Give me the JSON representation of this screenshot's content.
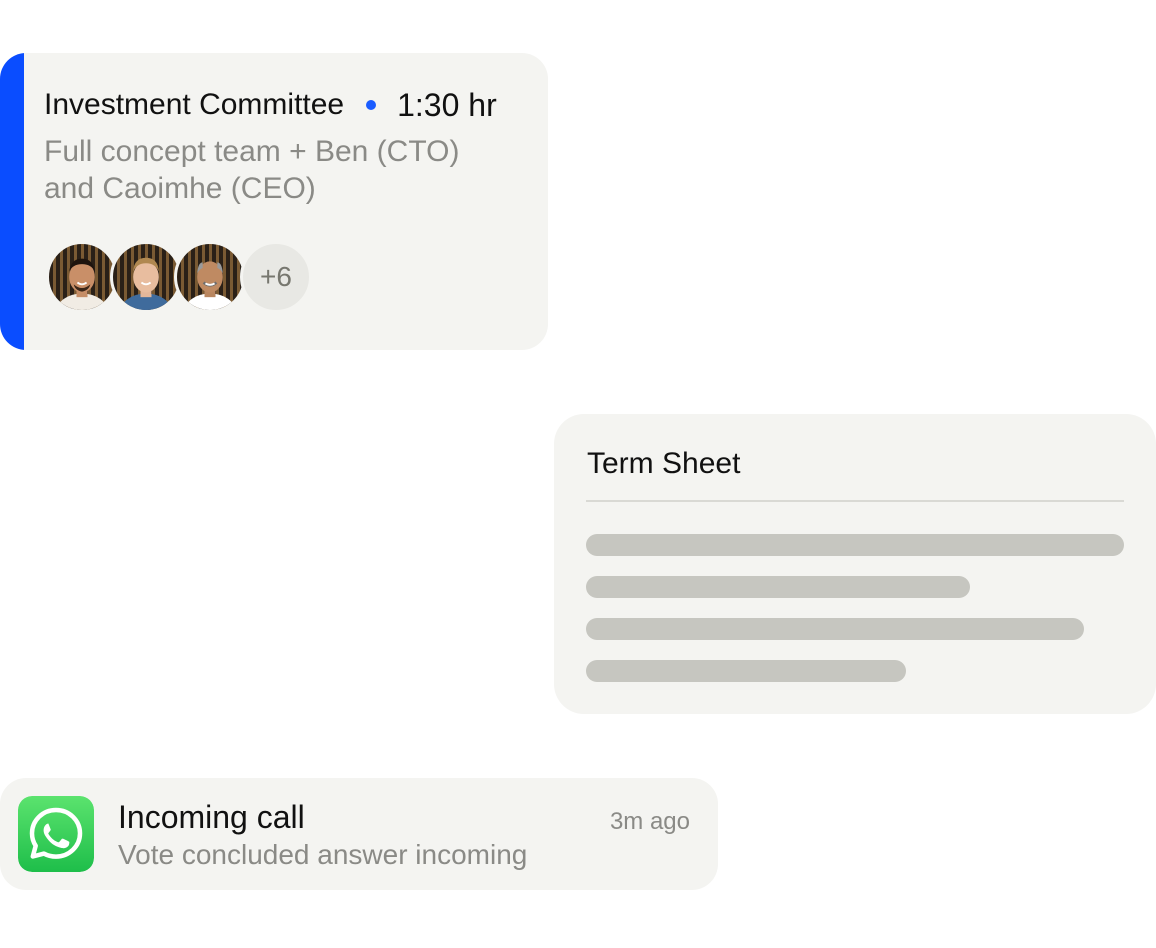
{
  "colors": {
    "accent_blue": "#0a4dff",
    "dot_blue": "#1a5cff",
    "card_bg": "#f4f4f1",
    "muted_text": "#8a8a86",
    "skeleton": "#c6c6c0",
    "whatsapp_green": "#25d366"
  },
  "meeting": {
    "title": "Investment Committee",
    "duration": "1:30 hr",
    "description": "Full concept team + Ben (CTO) and Caoimhe (CEO)",
    "attendees": [
      {
        "icon": "attendee-avatar-1"
      },
      {
        "icon": "attendee-avatar-2"
      },
      {
        "icon": "attendee-avatar-3"
      }
    ],
    "more_count": "+6"
  },
  "term_sheet": {
    "title": "Term Sheet",
    "placeholder_lines": 4
  },
  "notification": {
    "app_icon": "whatsapp-icon",
    "title": "Incoming call",
    "body": "Vote concluded answer incoming",
    "time": "3m ago"
  }
}
